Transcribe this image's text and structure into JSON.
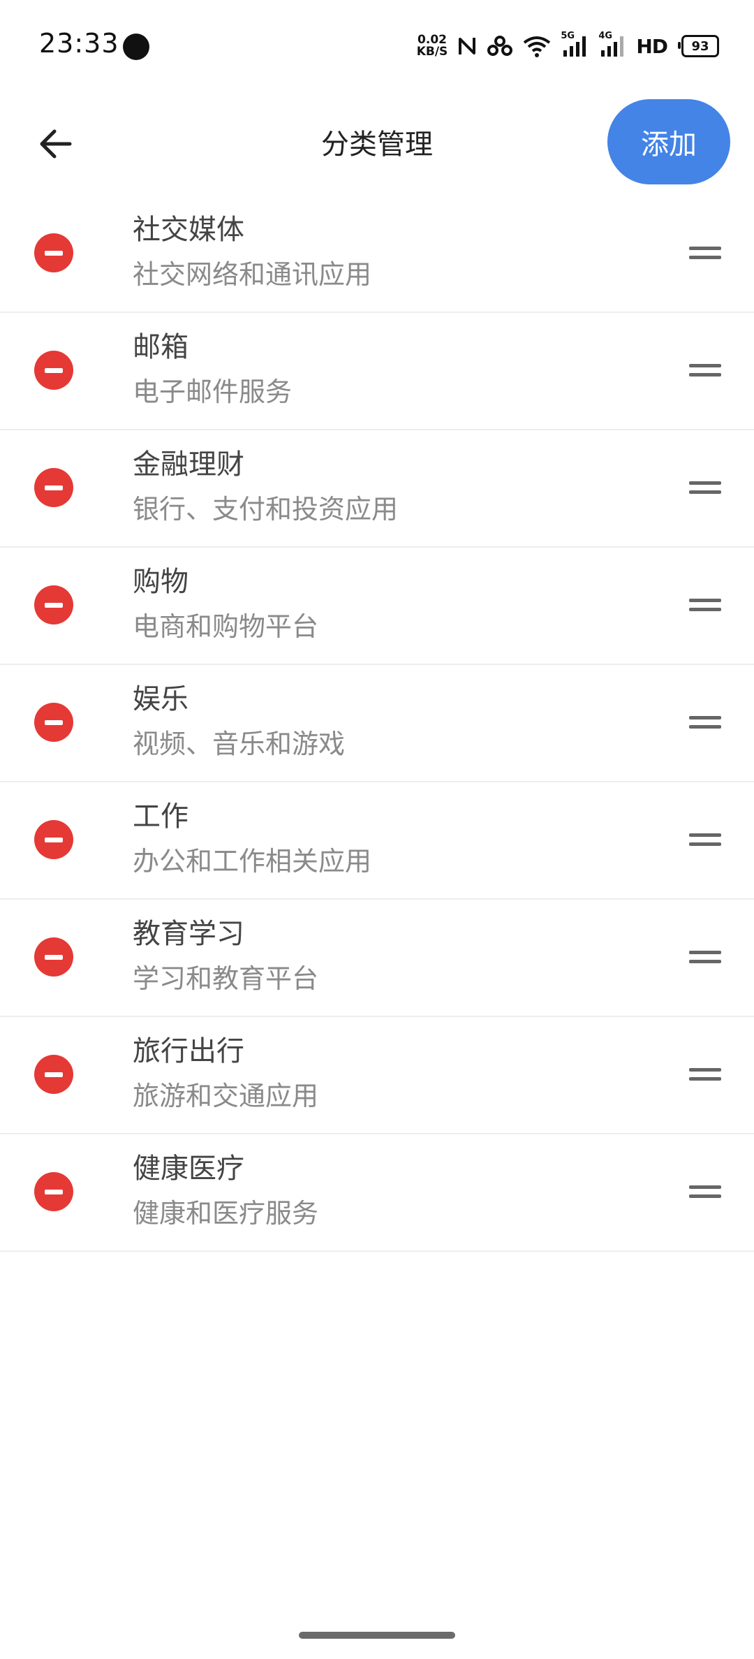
{
  "status_bar": {
    "time": "23:33",
    "net_speed_value": "0.02",
    "net_speed_unit": "KB/S",
    "network_5g": "5G",
    "network_4g": "4G",
    "hd_label": "HD",
    "battery_level": "93"
  },
  "header": {
    "title": "分类管理",
    "add_label": "添加"
  },
  "categories": [
    {
      "name": "社交媒体",
      "description": "社交网络和通讯应用"
    },
    {
      "name": "邮箱",
      "description": "电子邮件服务"
    },
    {
      "name": "金融理财",
      "description": "银行、支付和投资应用"
    },
    {
      "name": "购物",
      "description": "电商和购物平台"
    },
    {
      "name": "娱乐",
      "description": "视频、音乐和游戏"
    },
    {
      "name": "工作",
      "description": "办公和工作相关应用"
    },
    {
      "name": "教育学习",
      "description": "学习和教育平台"
    },
    {
      "name": "旅行出行",
      "description": "旅游和交通应用"
    },
    {
      "name": "健康医疗",
      "description": "健康和医疗服务"
    }
  ],
  "colors": {
    "accent": "#4384e6",
    "remove": "#e53935"
  }
}
